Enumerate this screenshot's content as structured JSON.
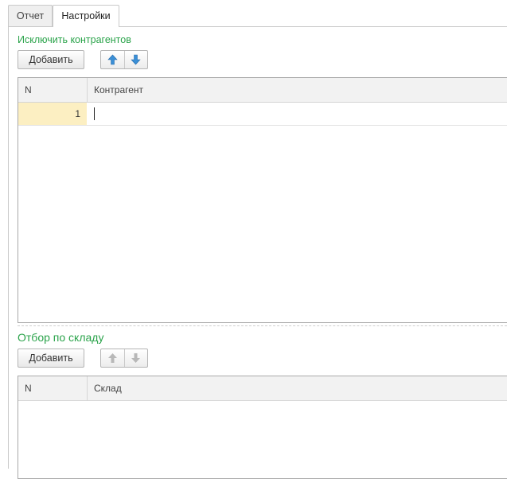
{
  "tabs": [
    {
      "label": "Отчет"
    },
    {
      "label": "Настройки"
    }
  ],
  "exclude_group": {
    "title": "Исключить контрагентов",
    "add_label": "Добавить",
    "columns": [
      "N",
      "Контрагент"
    ],
    "rows": [
      {
        "n": "1",
        "value": ""
      }
    ]
  },
  "warehouse_group": {
    "title": "Отбор по складу",
    "add_label": "Добавить",
    "columns": [
      "N",
      "Склад"
    ],
    "rows": []
  },
  "colors": {
    "group_title": "#2aa34a",
    "arrow_active": "#3a8fd6",
    "arrow_disabled": "#b8b8b8",
    "selected_cell": "#fcefc2"
  },
  "icons": {
    "move_up": "arrow-up-icon",
    "move_down": "arrow-down-icon"
  }
}
